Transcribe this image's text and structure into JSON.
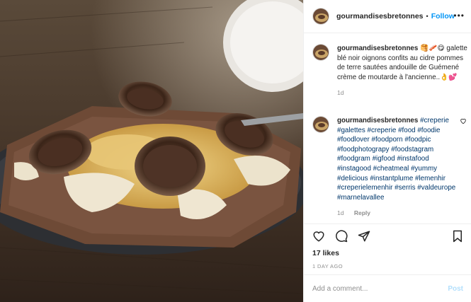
{
  "post": {
    "username": "gourmandisesbretonnes",
    "dot": "•",
    "follow_label": "Follow",
    "more_label": "•••"
  },
  "caption": {
    "username": "gourmandisesbretonnes",
    "emoji": "🥞🥓😋",
    "text": "galette blé noir oignons confits au cidre pommes de terre sautées andouille de Guémené crème de moutarde à l'ancienne..👌💕",
    "age": "1d"
  },
  "hashtag_comment": {
    "username": "gourmandisesbretonnes",
    "tags": [
      "#creperie",
      "#galettes",
      "#creperie",
      "#food",
      "#foodie",
      "#foodlover",
      "#foodporn",
      "#foodpic",
      "#foodphotograpy",
      "#foodstagram",
      "#foodgram",
      "#igfood",
      "#instafood",
      "#instagood",
      "#cheatmeal",
      "#yummy",
      "#delicious",
      "#instantplume",
      "#lemenhir",
      "#creperielemenhir",
      "#serris",
      "#valdeurope",
      "#marnelavallee"
    ],
    "age": "1d",
    "reply_label": "Reply"
  },
  "actions": {
    "likes": "17 likes",
    "timestamp": "1 DAY AGO",
    "comment_placeholder": "Add a comment...",
    "post_label": "Post"
  },
  "icons": [
    "heart-icon",
    "comment-icon",
    "share-icon",
    "bookmark-icon",
    "small-heart-icon",
    "more-icon"
  ],
  "colors": {
    "link": "#0095f6",
    "hashtag": "#00376b",
    "muted": "#8e8e8e",
    "post_disabled": "#b2dffc"
  }
}
